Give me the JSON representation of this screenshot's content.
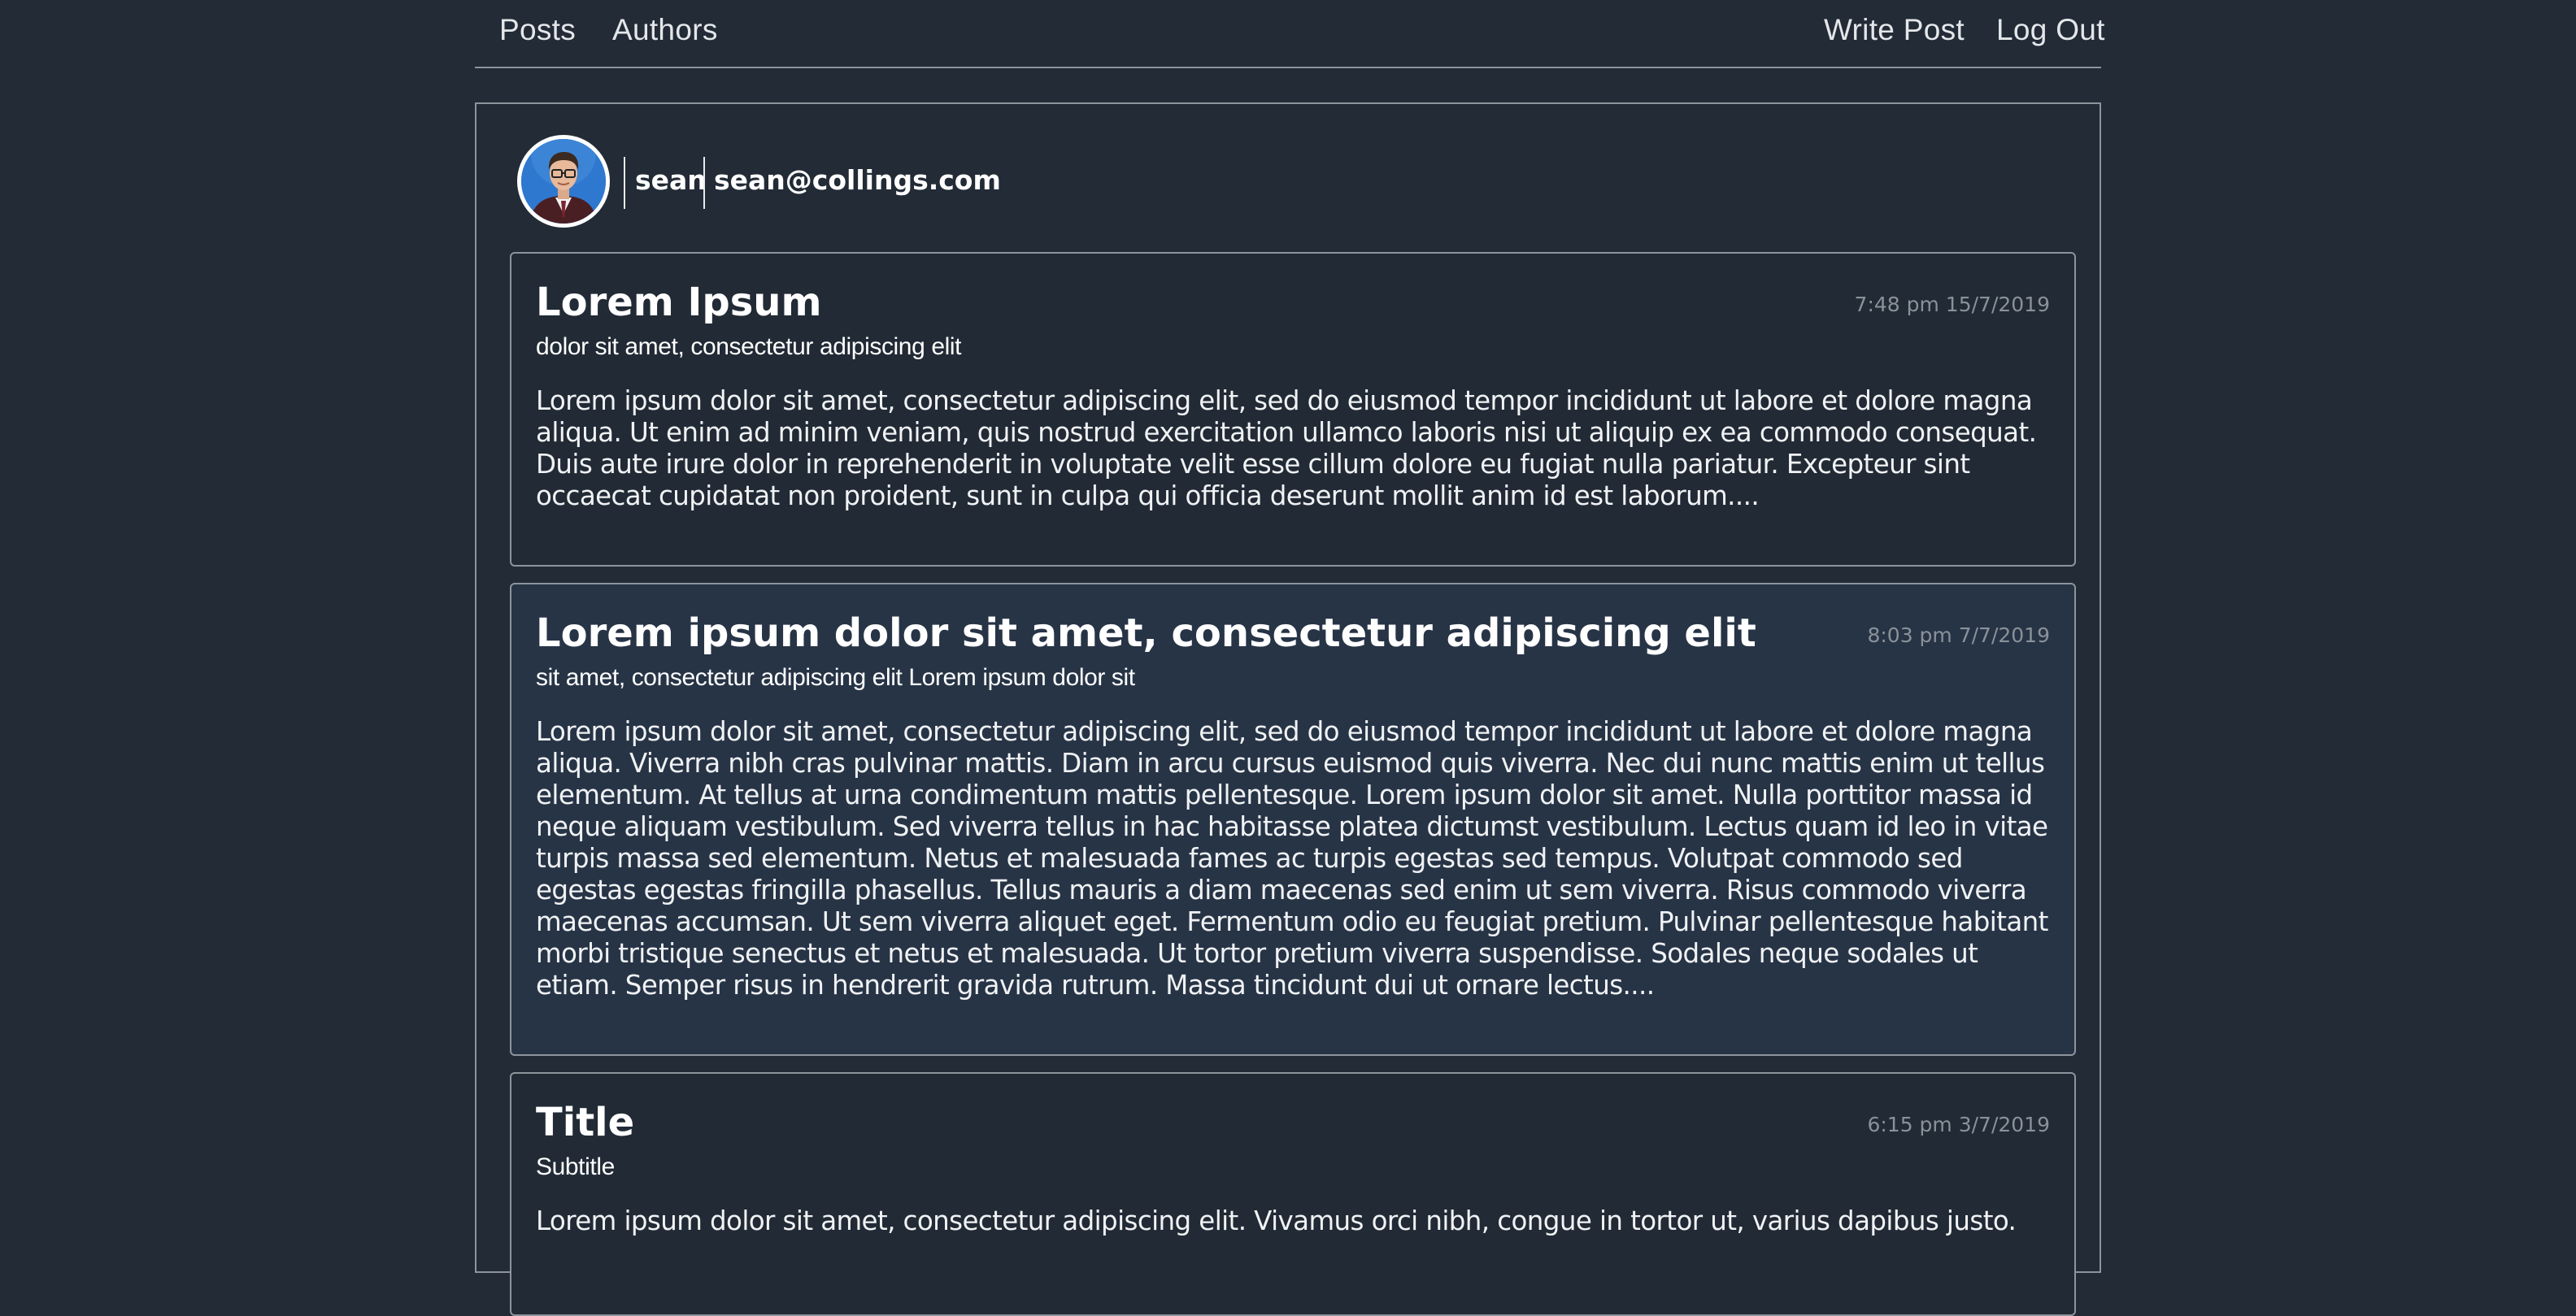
{
  "nav": {
    "left": [
      "Posts",
      "Authors"
    ],
    "right": [
      "Write Post",
      "Log Out"
    ]
  },
  "profile": {
    "username": "sean",
    "email": "sean@collings.com"
  },
  "posts": [
    {
      "title": "Lorem Ipsum",
      "subtitle": "dolor sit amet, consectetur adipiscing elit",
      "time": "7:48 pm 15/7/2019",
      "body": "Lorem ipsum dolor sit amet, consectetur adipiscing elit, sed do eiusmod tempor incididunt ut labore et dolore magna aliqua. Ut enim ad minim veniam, quis nostrud exercitation ullamco laboris nisi ut aliquip ex ea commodo consequat. Duis aute irure dolor in reprehenderit in voluptate velit esse cillum dolore eu fugiat nulla pariatur. Excepteur sint occaecat cupidatat non proident, sunt in culpa qui officia deserunt mollit anim id est laborum...."
    },
    {
      "title": "Lorem ipsum dolor sit amet, consectetur adipiscing elit",
      "subtitle": "sit amet, consectetur adipiscing elit Lorem ipsum dolor sit",
      "time": "8:03 pm 7/7/2019",
      "body": "Lorem ipsum dolor sit amet, consectetur adipiscing elit, sed do eiusmod tempor incididunt ut labore et dolore magna aliqua. Viverra nibh cras pulvinar mattis. Diam in arcu cursus euismod quis viverra. Nec dui nunc mattis enim ut tellus elementum. At tellus at urna condimentum mattis pellentesque. Lorem ipsum dolor sit amet. Nulla porttitor massa id neque aliquam vestibulum. Sed viverra tellus in hac habitasse platea dictumst vestibulum. Lectus quam id leo in vitae turpis massa sed elementum. Netus et malesuada fames ac turpis egestas sed tempus. Volutpat commodo sed egestas egestas fringilla phasellus. Tellus mauris a diam maecenas sed enim ut sem viverra. Risus commodo viverra maecenas accumsan. Ut sem viverra aliquet eget. Fermentum odio eu feugiat pretium. Pulvinar pellentesque habitant morbi tristique senectus et netus et malesuada. Ut tortor pretium viverra suspendisse. Sodales neque sodales ut etiam. Semper risus in hendrerit gravida rutrum. Massa tincidunt dui ut ornare lectus...."
    },
    {
      "title": "Title",
      "subtitle": "Subtitle",
      "time": "6:15 pm 3/7/2019",
      "body": "Lorem ipsum dolor sit amet, consectetur adipiscing elit. Vivamus orci nibh, congue in tortor ut, varius dapibus justo."
    }
  ]
}
